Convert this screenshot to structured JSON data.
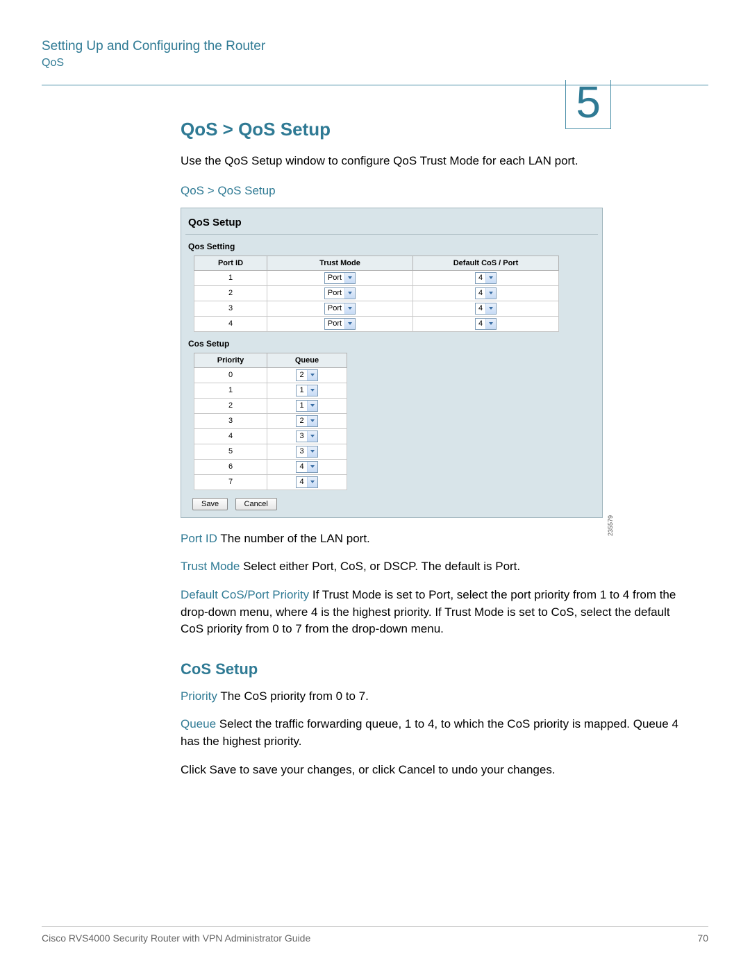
{
  "header": {
    "chapter_title": "Setting Up and Configuring the Router",
    "section_name": "QoS",
    "chapter_number": "5"
  },
  "main": {
    "h1": "QoS > QoS Setup",
    "intro": "Use the QoS Setup window to configure QoS Trust Mode for each LAN port.",
    "caption": "QoS > QoS Setup"
  },
  "screenshot": {
    "title": "QoS Setup",
    "qos_setting_label": "Qos Setting",
    "cos_setup_label": "Cos Setup",
    "qos_table": {
      "headers": [
        "Port ID",
        "Trust Mode",
        "Default CoS / Port"
      ],
      "rows": [
        {
          "port_id": "1",
          "trust_mode": "Port",
          "default": "4"
        },
        {
          "port_id": "2",
          "trust_mode": "Port",
          "default": "4"
        },
        {
          "port_id": "3",
          "trust_mode": "Port",
          "default": "4"
        },
        {
          "port_id": "4",
          "trust_mode": "Port",
          "default": "4"
        }
      ]
    },
    "cos_table": {
      "headers": [
        "Priority",
        "Queue"
      ],
      "rows": [
        {
          "priority": "0",
          "queue": "2"
        },
        {
          "priority": "1",
          "queue": "1"
        },
        {
          "priority": "2",
          "queue": "1"
        },
        {
          "priority": "3",
          "queue": "2"
        },
        {
          "priority": "4",
          "queue": "3"
        },
        {
          "priority": "5",
          "queue": "3"
        },
        {
          "priority": "6",
          "queue": "4"
        },
        {
          "priority": "7",
          "queue": "4"
        }
      ]
    },
    "save_label": "Save",
    "cancel_label": "Cancel",
    "image_id": "235579"
  },
  "descriptions": {
    "port_id_term": "Port ID",
    "port_id_text": " The number of the LAN port.",
    "trust_mode_term": "Trust Mode",
    "trust_mode_text": " Select either Port, CoS, or DSCP. The default is Port.",
    "default_cos_term": "Default CoS/Port Priority",
    "default_cos_text": " If Trust Mode is set to Port, select the port priority from 1 to 4 from the drop-down menu, where 4 is the highest priority. If Trust Mode is set to CoS, select the default CoS priority from 0 to 7 from the drop-down menu.",
    "cos_heading": "CoS Setup",
    "priority_term": "Priority",
    "priority_text": " The CoS priority from 0 to 7.",
    "queue_term": "Queue",
    "queue_text": " Select the traffic forwarding queue, 1 to 4, to which the CoS priority is mapped. Queue 4 has the highest priority.",
    "save_note": "Click Save to save your changes, or click Cancel to undo your changes."
  },
  "footer": {
    "guide_name": "Cisco RVS4000 Security Router with VPN Administrator Guide",
    "page_number": "70"
  }
}
